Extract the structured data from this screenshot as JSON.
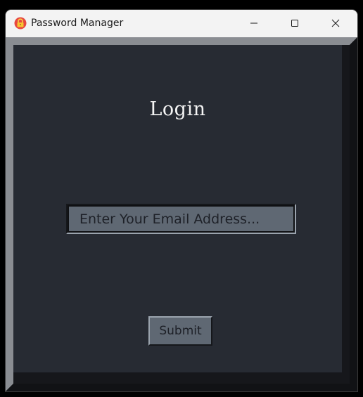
{
  "window": {
    "title": "Password Manager",
    "app_icon": "padlock-icon",
    "controls": {
      "minimize_icon": "minimize-icon",
      "maximize_icon": "maximize-icon",
      "close_icon": "close-icon"
    }
  },
  "login": {
    "heading": "Login",
    "email_placeholder": "Enter Your Email Address...",
    "email_value": "",
    "submit_label": "Submit"
  },
  "colors": {
    "panel_background": "#272b33",
    "field_background": "#5f6873",
    "heading_text": "#f4f4f4",
    "titlebar": "#f3f3f3"
  }
}
